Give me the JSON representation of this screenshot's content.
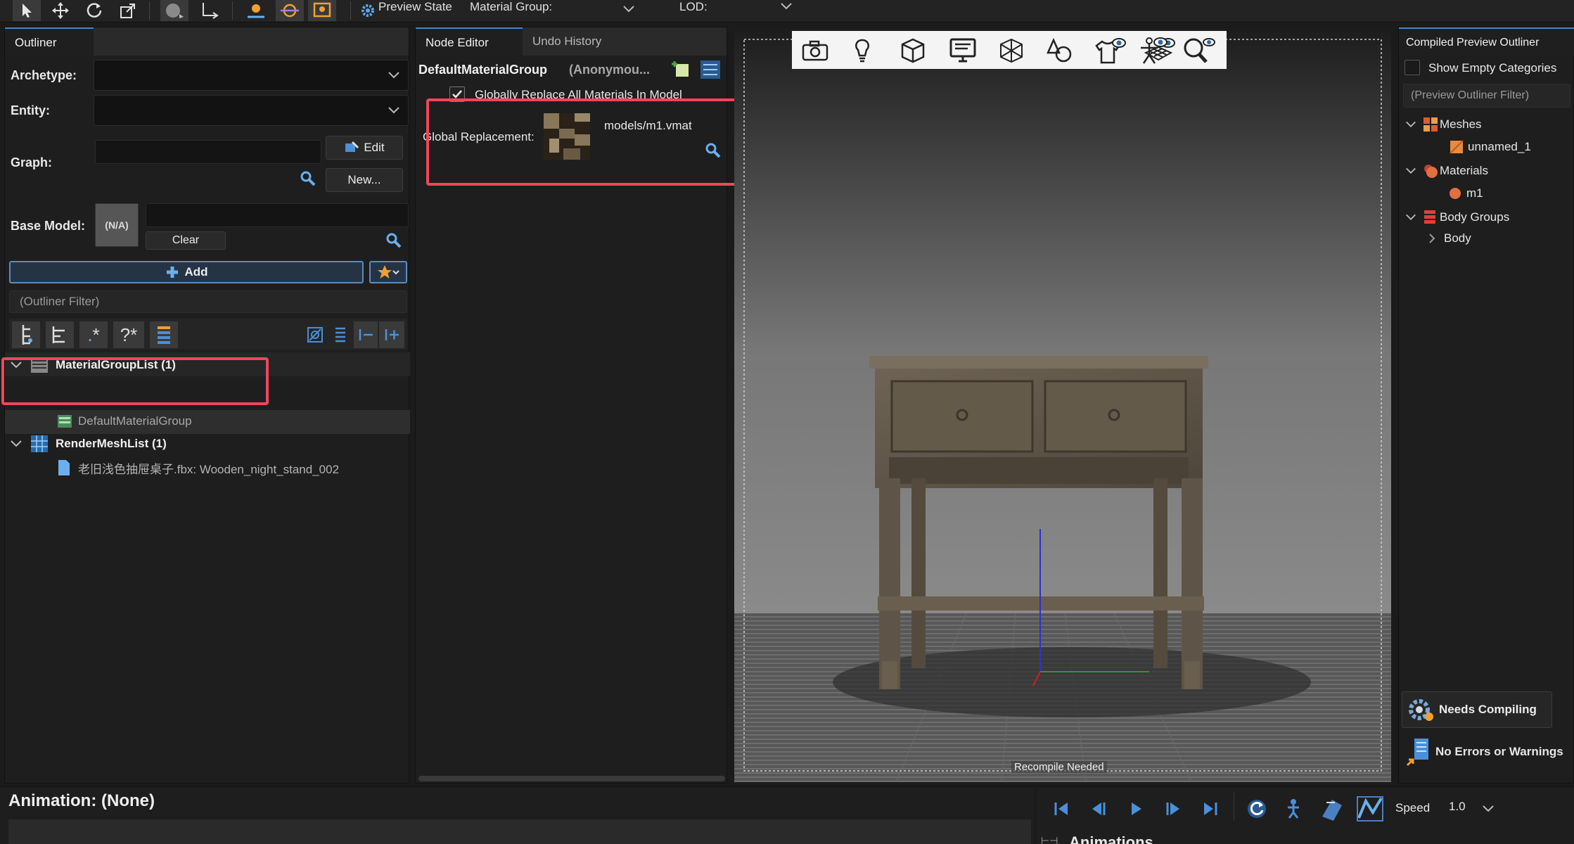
{
  "toolbar": {
    "preview_state": "Preview State",
    "material_group_label": "Material Group:",
    "lod_label": "LOD:"
  },
  "outliner": {
    "tab": "Outliner",
    "archetype_label": "Archetype:",
    "entity_label": "Entity:",
    "graph_label": "Graph:",
    "edit_label": "Edit",
    "new_label": "New...",
    "base_model_label": "Base Model:",
    "na_label": "(N/A)",
    "clear_label": "Clear",
    "add_label": "Add",
    "filter_placeholder": "(Outliner Filter)",
    "tree": [
      {
        "label": "MaterialGroupList (1)",
        "child": "DefaultMaterialGroup"
      },
      {
        "label": "RenderMeshList (1)",
        "child": "老旧浅色抽屉桌子.fbx: Wooden_night_stand_002"
      }
    ]
  },
  "node_editor": {
    "tab_active": "Node Editor",
    "tab_other": "Undo History",
    "title": "DefaultMaterialGroup",
    "subtitle": "(Anonymou...",
    "checkbox_label": "Globally Replace All Materials In Model",
    "replacement_label": "Global Replacement:",
    "material_path": "models/m1.vmat"
  },
  "viewport": {
    "status": "Recompile Needed",
    "icons": [
      "camera-icon",
      "light-icon",
      "cube-icon",
      "monitor-icon",
      "wireframe-icon",
      "shapes-icon",
      "shirt-eye-icon",
      "grid-eye-icon",
      "skeleton-eye-icon",
      "magnifier-icon"
    ]
  },
  "preview_outliner": {
    "title": "Compiled Preview Outliner",
    "show_empty_label": "Show Empty Categories",
    "filter_placeholder": "(Preview Outliner Filter)",
    "items": [
      {
        "label": "Meshes",
        "child": "unnamed_1"
      },
      {
        "label": "Materials",
        "child": "m1"
      },
      {
        "label": "Body Groups",
        "child": "Body"
      }
    ],
    "needs_compiling": "Needs Compiling",
    "no_errors": "No Errors or Warnings"
  },
  "animation": {
    "label": "Animation: (None)",
    "speed_label": "Speed",
    "speed_value": "1.0",
    "animations_label": "Animations"
  },
  "colors": {
    "accent": "#3e8bd6",
    "highlight_box": "#f0465a"
  }
}
